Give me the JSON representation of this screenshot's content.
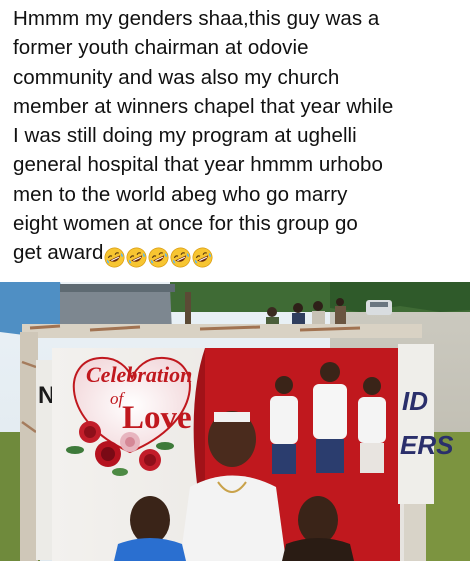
{
  "post": {
    "lines": [
      "Hmmm my genders shaa,this guy was a",
      "former youth chairman at odovie",
      "community and was also my church",
      "member at winners chapel that year while",
      "I was still doing  my program at ughelli",
      "general hospital that year hmmm urhobo",
      "men to the world abeg who go marry",
      "eight women at once for this group go",
      "get award"
    ],
    "emojis": [
      "rolling-on-floor-laughing",
      "rolling-on-floor-laughing",
      "rolling-on-floor-laughing",
      "rolling-on-floor-laughing",
      "rolling-on-floor-laughing"
    ]
  },
  "photo": {
    "banner": {
      "title_line1": "Celebration",
      "title_line2": "of",
      "title_line3": "Love",
      "left_edge_letter": "N",
      "right_edge_text_1": "ID",
      "right_edge_text_2": "ERS"
    }
  },
  "colors": {
    "text": "#111111",
    "banner_red": "#c0181e",
    "emoji_yellow": "#f7c531"
  }
}
